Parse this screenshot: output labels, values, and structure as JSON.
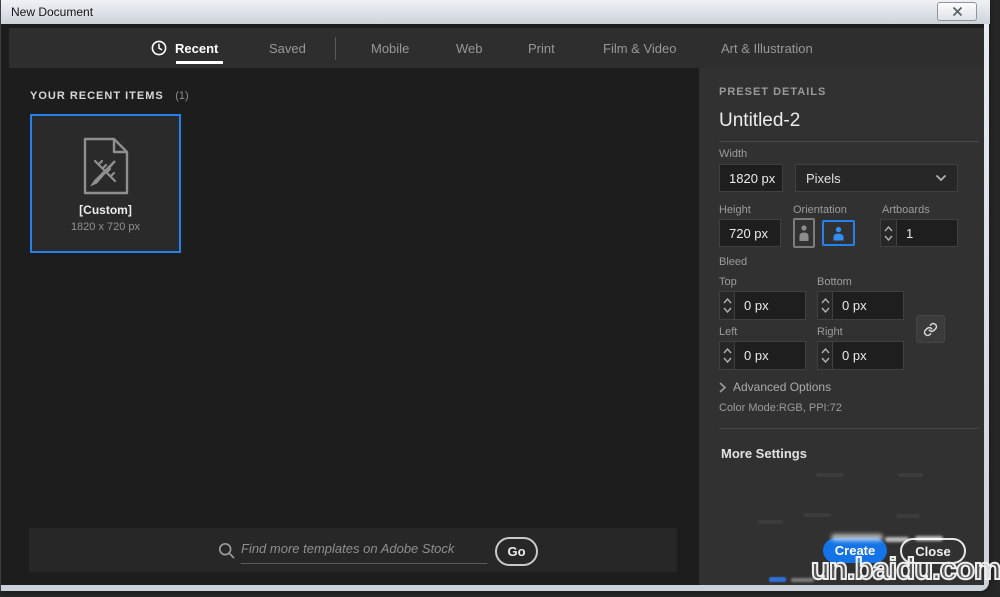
{
  "window": {
    "title": "New Document"
  },
  "tabs": [
    {
      "label": "Recent",
      "active": true
    },
    {
      "label": "Saved"
    },
    {
      "label": "Mobile"
    },
    {
      "label": "Web"
    },
    {
      "label": "Print"
    },
    {
      "label": "Film & Video"
    },
    {
      "label": "Art & Illustration"
    }
  ],
  "recent": {
    "heading": "YOUR RECENT ITEMS",
    "count": "(1)",
    "items": [
      {
        "name": "[Custom]",
        "dimensions": "1820 x 720 px",
        "selected": true
      }
    ]
  },
  "search": {
    "placeholder": "Find more templates on Adobe Stock",
    "go_label": "Go"
  },
  "preset": {
    "heading": "PRESET DETAILS",
    "name": "Untitled-2",
    "width": {
      "label": "Width",
      "value": "1820 px"
    },
    "units": {
      "value": "Pixels"
    },
    "height": {
      "label": "Height",
      "value": "720 px"
    },
    "orientation": {
      "label": "Orientation",
      "selected": "landscape"
    },
    "artboards": {
      "label": "Artboards",
      "value": "1"
    },
    "bleed": {
      "label": "Bleed",
      "top": {
        "label": "Top",
        "value": "0 px"
      },
      "bottom": {
        "label": "Bottom",
        "value": "0 px"
      },
      "left": {
        "label": "Left",
        "value": "0 px"
      },
      "right": {
        "label": "Right",
        "value": "0 px"
      }
    },
    "advanced_options": "Advanced Options",
    "color_mode": "Color Mode:RGB, PPI:72",
    "more_settings": "More Settings"
  },
  "actions": {
    "create": "Create",
    "close": "Close"
  },
  "watermark": "un.baidu.com",
  "colors": {
    "accent": "#2680eb",
    "create_button": "#1473e6"
  }
}
